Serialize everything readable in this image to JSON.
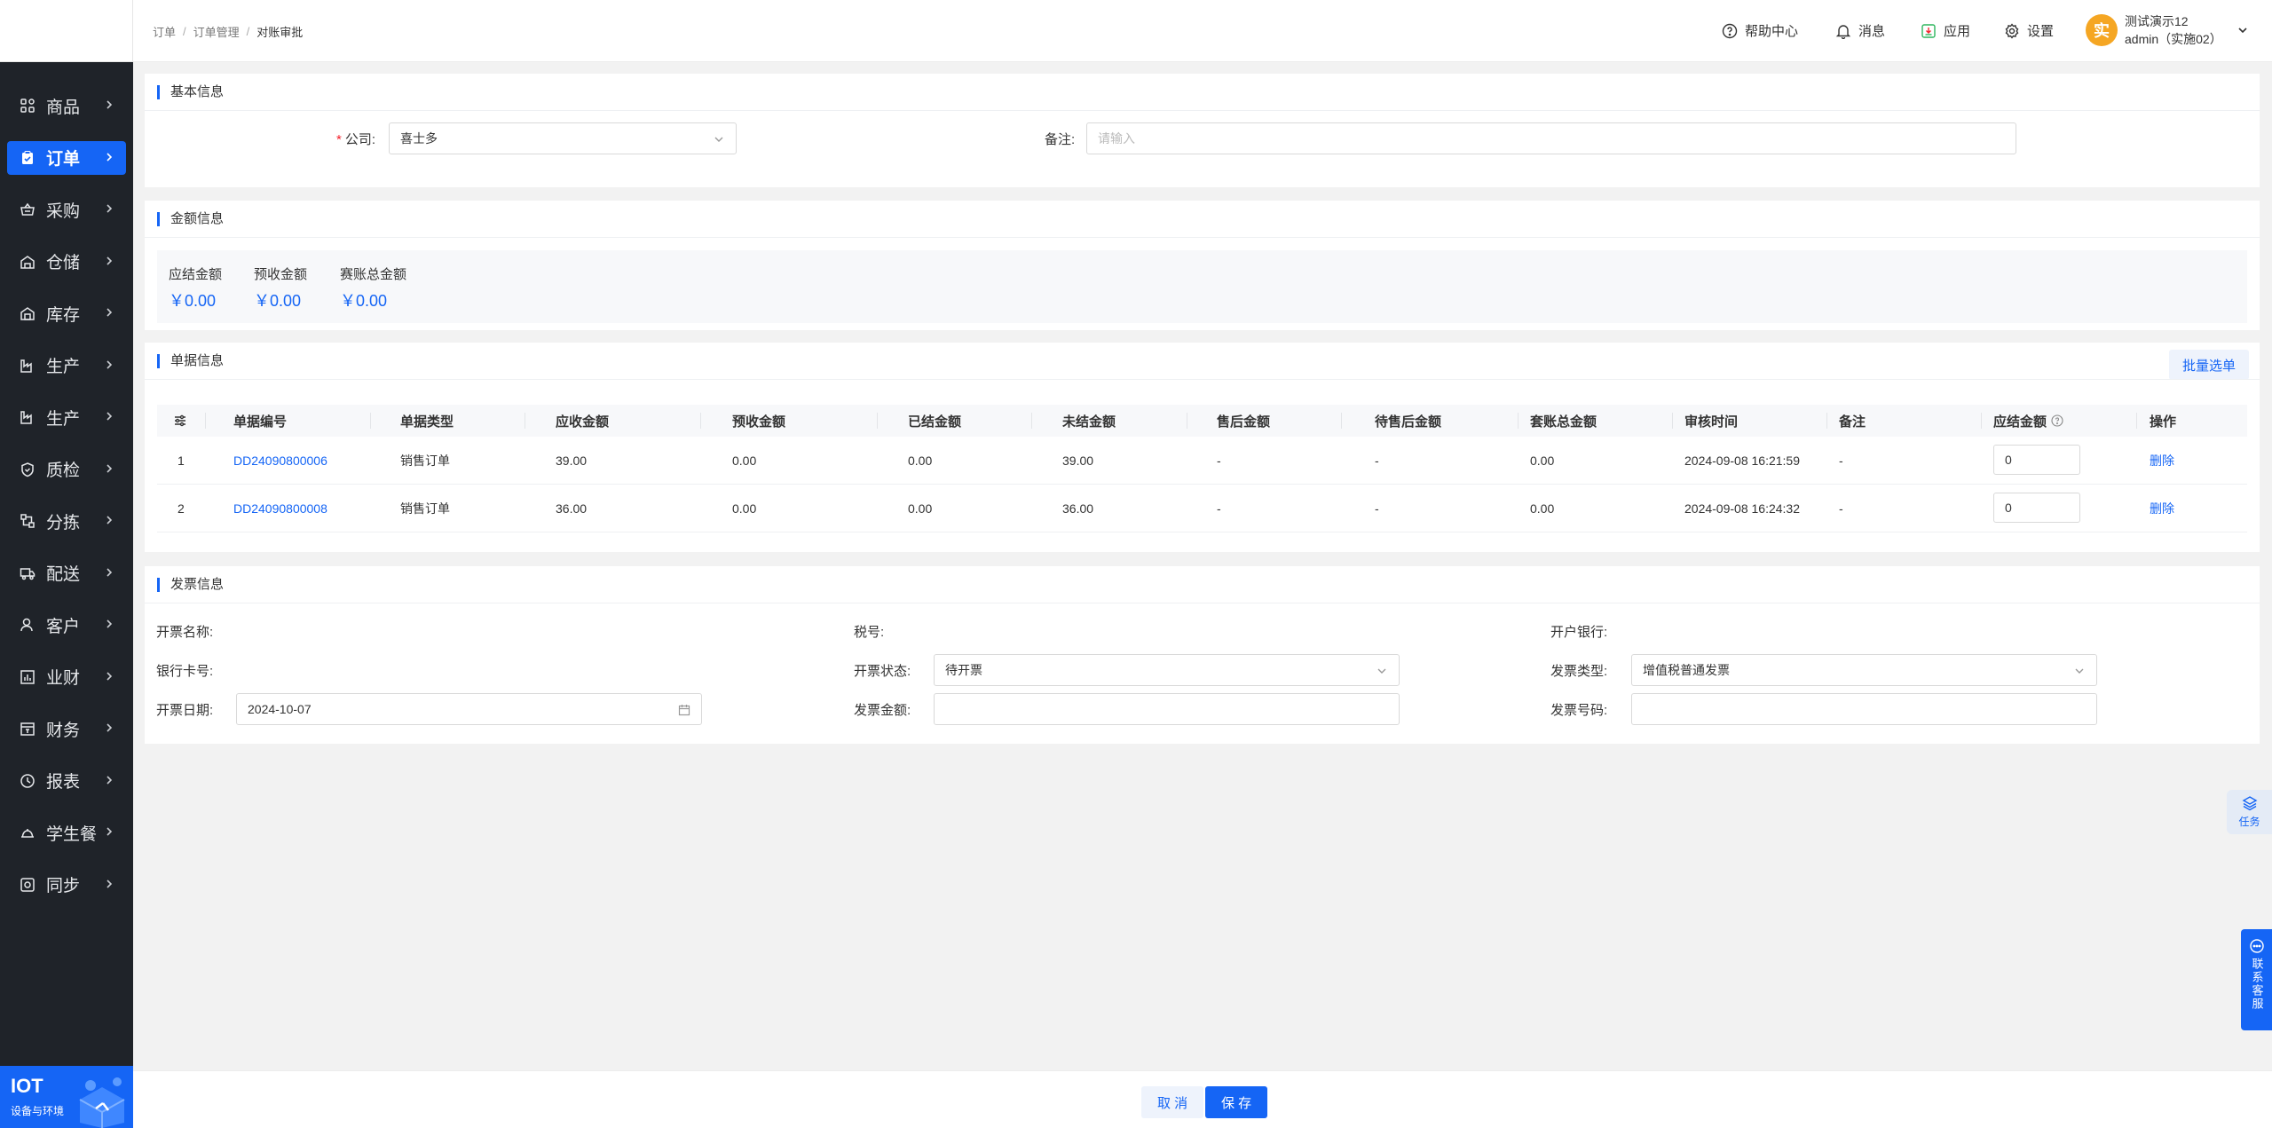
{
  "sidebar": {
    "items": [
      {
        "label": "商品",
        "icon": "grid-icon",
        "active": false
      },
      {
        "label": "订单",
        "icon": "clipboard-icon",
        "active": true
      },
      {
        "label": "采购",
        "icon": "basket-icon",
        "active": false
      },
      {
        "label": "仓储",
        "icon": "warehouse-icon",
        "active": false
      },
      {
        "label": "库存",
        "icon": "stock-icon",
        "active": false
      },
      {
        "label": "生产",
        "icon": "factory-icon",
        "active": false
      },
      {
        "label": "生产",
        "icon": "factory-icon",
        "active": false
      },
      {
        "label": "质检",
        "icon": "shield-icon",
        "active": false
      },
      {
        "label": "分拣",
        "icon": "sort-icon",
        "active": false
      },
      {
        "label": "配送",
        "icon": "truck-icon",
        "active": false
      },
      {
        "label": "客户",
        "icon": "user-icon",
        "active": false
      },
      {
        "label": "业财",
        "icon": "chart-icon",
        "active": false
      },
      {
        "label": "财务",
        "icon": "finance-icon",
        "active": false
      },
      {
        "label": "报表",
        "icon": "report-icon",
        "active": false
      },
      {
        "label": "学生餐",
        "icon": "meal-icon",
        "active": false
      },
      {
        "label": "同步",
        "icon": "sync-icon",
        "active": false
      }
    ],
    "banner": {
      "title": "IOT",
      "subtitle": "设备与环境"
    }
  },
  "header": {
    "breadcrumb": [
      "订单",
      "订单管理",
      "对账审批"
    ],
    "help": "帮助中心",
    "messages": "消息",
    "apps": "应用",
    "settings": "设置",
    "user": {
      "avatar": "实",
      "name": "测试演示12",
      "account": "admin（实施02）"
    }
  },
  "basic": {
    "title": "基本信息",
    "company_label": "公司:",
    "company_value": "喜士多",
    "remark_label": "备注:",
    "remark_placeholder": "请输入"
  },
  "amount": {
    "title": "金额信息",
    "items": [
      {
        "label": "应结金额",
        "value": "￥0.00"
      },
      {
        "label": "预收金额",
        "value": "￥0.00"
      },
      {
        "label": "赛账总金额",
        "value": "￥0.00"
      }
    ]
  },
  "docs": {
    "title": "单据信息",
    "batch_button": "批量选单",
    "columns": [
      "单据编号",
      "单据类型",
      "应收金额",
      "预收金额",
      "已结金额",
      "未结金额",
      "售后金额",
      "待售后金额",
      "套账总金额",
      "审核时间",
      "备注",
      "应结金额",
      "操作"
    ],
    "rows": [
      {
        "index": "1",
        "code": "DD24090800006",
        "type": "销售订单",
        "receivable": "39.00",
        "prepaid": "0.00",
        "settled": "0.00",
        "unsettled": "39.00",
        "aftersale": "-",
        "pending": "-",
        "total": "0.00",
        "time": "2024-09-08 16:21:59",
        "remark": "-",
        "settle": "0",
        "action": "删除"
      },
      {
        "index": "2",
        "code": "DD24090800008",
        "type": "销售订单",
        "receivable": "36.00",
        "prepaid": "0.00",
        "settled": "0.00",
        "unsettled": "36.00",
        "aftersale": "-",
        "pending": "-",
        "total": "0.00",
        "time": "2024-09-08 16:24:32",
        "remark": "-",
        "settle": "0",
        "action": "删除"
      }
    ]
  },
  "invoice": {
    "title": "发票信息",
    "name_label": "开票名称:",
    "tax_label": "税号:",
    "bank_label": "开户银行:",
    "card_label": "银行卡号:",
    "status_label": "开票状态:",
    "status_value": "待开票",
    "type_label": "发票类型:",
    "type_value": "增值税普通发票",
    "date_label": "开票日期:",
    "date_value": "2024-10-07",
    "amount_label": "发票金额:",
    "number_label": "发票号码:"
  },
  "footer": {
    "cancel": "取 消",
    "save": "保 存"
  },
  "floats": {
    "task": "任务",
    "service": "联系客服"
  },
  "colors": {
    "accent": "#1565f5",
    "sidebar_bg": "#1f2329",
    "avatar": "#f5a623"
  }
}
